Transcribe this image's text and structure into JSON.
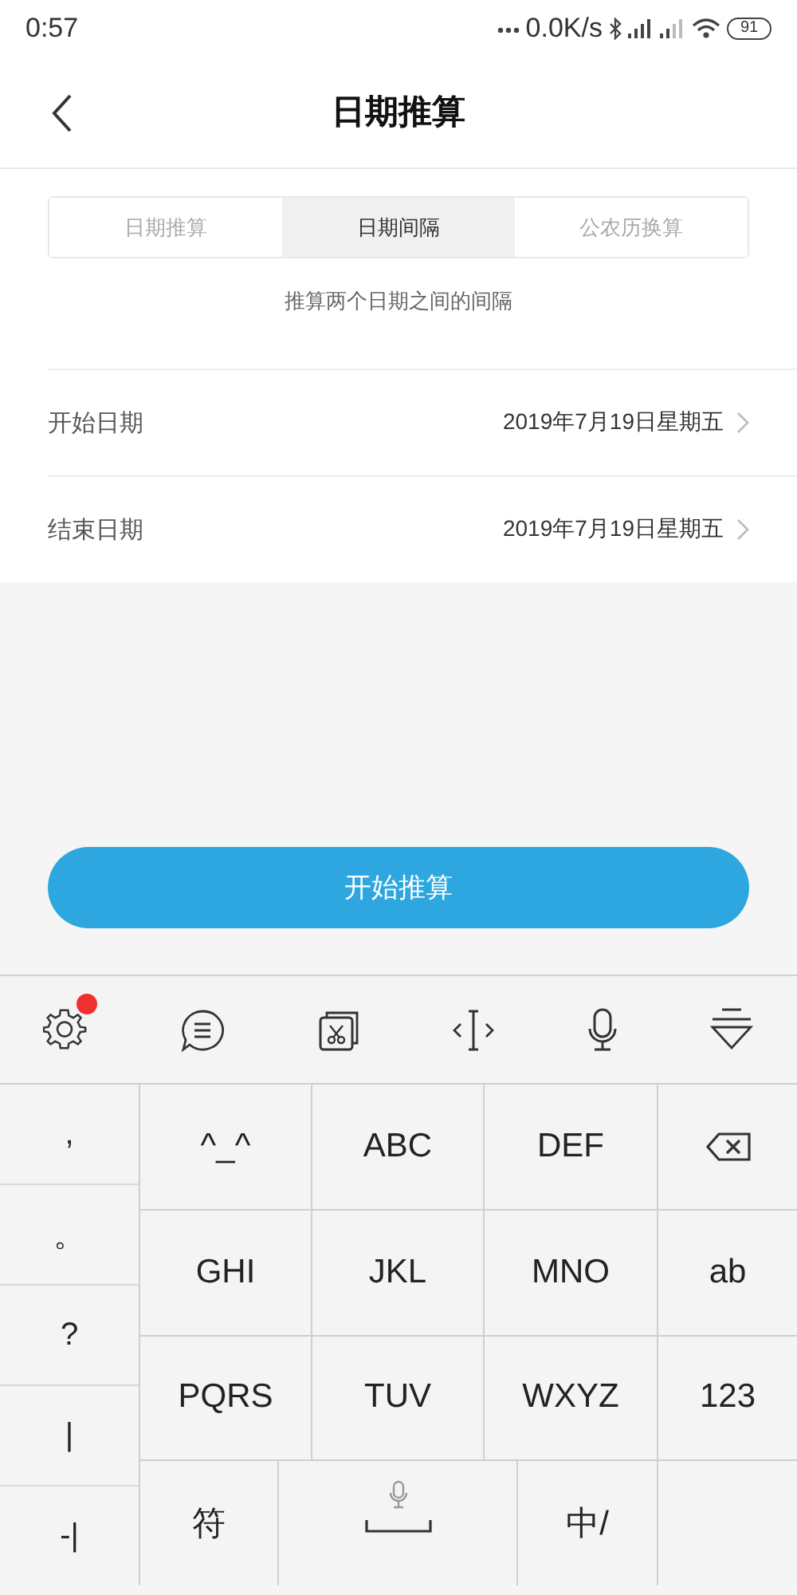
{
  "status_bar": {
    "time": "0:57",
    "net_speed": "0.0K/s",
    "battery": "91"
  },
  "header": {
    "title": "日期推算"
  },
  "tabs": [
    {
      "label": "日期推算",
      "selected": false
    },
    {
      "label": "日期间隔",
      "selected": true
    },
    {
      "label": "公农历换算",
      "selected": false
    }
  ],
  "subtitle": "推算两个日期之间的间隔",
  "date_rows": [
    {
      "label": "开始日期",
      "value": "2019年7月19日星期五"
    },
    {
      "label": "结束日期",
      "value": "2019年7月19日星期五"
    }
  ],
  "start_button": "开始推算",
  "keyboard": {
    "toolbar": [
      {
        "kind": "settings",
        "badge": true
      },
      {
        "kind": "chat",
        "badge": false
      },
      {
        "kind": "clipboard",
        "badge": false
      },
      {
        "kind": "cursor",
        "badge": false
      },
      {
        "kind": "mic",
        "badge": false
      },
      {
        "kind": "collapse",
        "badge": false
      }
    ],
    "symbol_keys": [
      ",",
      "。",
      "?",
      "|",
      "-|"
    ],
    "rows": [
      [
        {
          "kind": "text",
          "label": "^_^"
        },
        {
          "kind": "text",
          "label": "ABC"
        },
        {
          "kind": "text",
          "label": "DEF"
        },
        {
          "kind": "backspace"
        }
      ],
      [
        {
          "kind": "text",
          "label": "GHI"
        },
        {
          "kind": "text",
          "label": "JKL"
        },
        {
          "kind": "text",
          "label": "MNO"
        },
        {
          "kind": "text",
          "label": "ab"
        }
      ],
      [
        {
          "kind": "text",
          "label": "PQRS"
        },
        {
          "kind": "text",
          "label": "TUV"
        },
        {
          "kind": "text",
          "label": "WXYZ"
        },
        {
          "kind": "text",
          "label": "123"
        }
      ],
      [
        {
          "kind": "text",
          "label": "符"
        },
        {
          "kind": "space"
        },
        {
          "kind": "text",
          "label": "中/"
        },
        {
          "kind": "blank"
        }
      ]
    ]
  }
}
